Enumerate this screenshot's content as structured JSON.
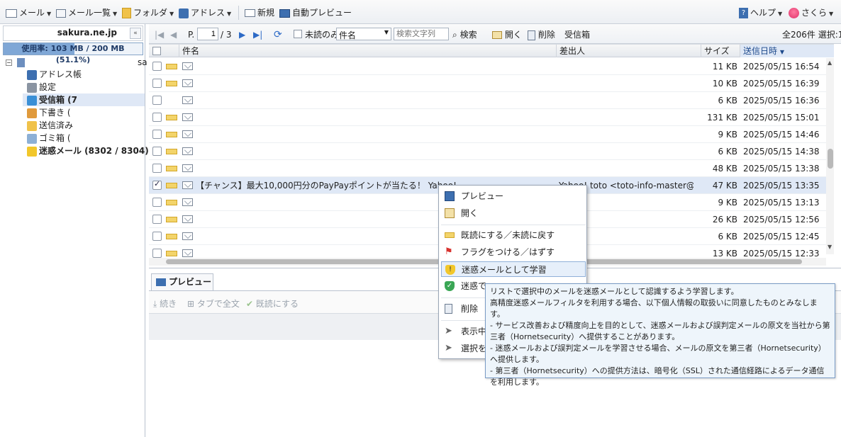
{
  "topbar": {
    "mail": "メール",
    "mail_list": "メール一覧",
    "folder": "フォルダ",
    "address": "アドレス",
    "new": "新規",
    "auto_preview": "自動プレビュー",
    "help": "ヘルプ",
    "user": "さくら"
  },
  "account": {
    "name": "sakura.ne.jp",
    "usage": "使用率: 103 MB / 200 MB (51.1%)",
    "usage_fraction": 0.511,
    "tree_suffix": "sa"
  },
  "tree": [
    {
      "label": "アドレス帳",
      "icon": "address-book-icon",
      "bold": false
    },
    {
      "label": "設定",
      "icon": "settings-icon",
      "bold": false
    },
    {
      "label": "受信箱 (7",
      "icon": "inbox-icon",
      "bold": true,
      "selected": true
    },
    {
      "label": "下書き (",
      "icon": "drafts-icon",
      "bold": false
    },
    {
      "label": "送信済み",
      "icon": "sent-icon",
      "bold": false
    },
    {
      "label": "ゴミ箱 (",
      "icon": "trash-icon",
      "bold": false
    },
    {
      "label": "迷惑メール (8302 / 8304)",
      "icon": "spam-icon",
      "bold": true
    }
  ],
  "listtool": {
    "page_label": "P.",
    "page_value": "1",
    "page_total": "/ 3",
    "unread_only": "未読のみ",
    "search_field": "件名",
    "search_placeholder": "検索文字列",
    "search": "検索",
    "open": "開く",
    "delete": "削除",
    "folder_name": "受信箱",
    "count": "全206件 選択:1"
  },
  "columns": {
    "subject": "件名",
    "sender": "差出人",
    "size": "サイズ",
    "date": "送信日時"
  },
  "rows": [
    {
      "new": true,
      "subject": "",
      "sender": "",
      "size": "11 KB",
      "date": "2025/05/15 16:54",
      "checked": false
    },
    {
      "new": true,
      "subject": "",
      "sender": "",
      "size": "10 KB",
      "date": "2025/05/15 16:39",
      "checked": false
    },
    {
      "new": false,
      "subject": "",
      "sender": "",
      "size": "6 KB",
      "date": "2025/05/15 16:36",
      "checked": false
    },
    {
      "new": true,
      "subject": "",
      "sender": "",
      "size": "131 KB",
      "date": "2025/05/15 15:01",
      "checked": false
    },
    {
      "new": true,
      "subject": "",
      "sender": "",
      "size": "9 KB",
      "date": "2025/05/15 14:46",
      "checked": false
    },
    {
      "new": true,
      "subject": "",
      "sender": "",
      "size": "6 KB",
      "date": "2025/05/15 14:38",
      "checked": false
    },
    {
      "new": true,
      "subject": "",
      "sender": "",
      "size": "48 KB",
      "date": "2025/05/15 13:38",
      "checked": false
    },
    {
      "new": true,
      "subject": "【チャンス】最大10,000円分のPayPayポイントが当たる！   Yahoo!",
      "sender": "Yahoo! toto <toto-info-master@mail....",
      "size": "47 KB",
      "date": "2025/05/15 13:35",
      "checked": true
    },
    {
      "new": true,
      "subject": "",
      "sender": "",
      "size": "9 KB",
      "date": "2025/05/15 13:13",
      "checked": false
    },
    {
      "new": true,
      "subject": "",
      "sender": "",
      "size": "26 KB",
      "date": "2025/05/15 12:56",
      "checked": false
    },
    {
      "new": true,
      "subject": "",
      "sender": "",
      "size": "6 KB",
      "date": "2025/05/15 12:45",
      "checked": false
    },
    {
      "new": true,
      "subject": "",
      "sender": "",
      "size": "13 KB",
      "date": "2025/05/15 12:33",
      "checked": false
    }
  ],
  "preview": {
    "tab": "プレビュー",
    "continue": "続き",
    "tab_full": "タブで全文",
    "mark_read": "既読にする"
  },
  "context_menu": {
    "preview": "プレビュー",
    "open": "開く",
    "toggle_read": "既読にする／未読に戻す",
    "flag": "フラグをつける／はずす",
    "learn_spam": "迷惑メールとして学習",
    "learn_not_spam": "迷惑で",
    "delete": "削除",
    "show": "表示中",
    "select": "選択を"
  },
  "tooltip": {
    "line1": "リストで選択中のメールを迷惑メールとして認識するよう学習します。",
    "line2": "高精度迷惑メールフィルタを利用する場合、以下個人情報の取扱いに同意したものとみなします。",
    "line3": "- サービス改善および精度向上を目的として、迷惑メールおよび誤判定メールの原文を当社から第三者（Hornetsecurity）へ提供することがあります。",
    "line4": "- 迷惑メールおよび誤判定メールを学習させる場合、メールの原文を第三者（Hornetsecurity）へ提供します。",
    "line5": "- 第三者（Hornetsecurity）への提供方法は、暗号化（SSL）された通信経路によるデータ通信を利用します。"
  },
  "colors": {
    "accent": "#4a78b5",
    "selected_row": "#dfe8f6",
    "tooltip_bg": "#eef5fb"
  }
}
